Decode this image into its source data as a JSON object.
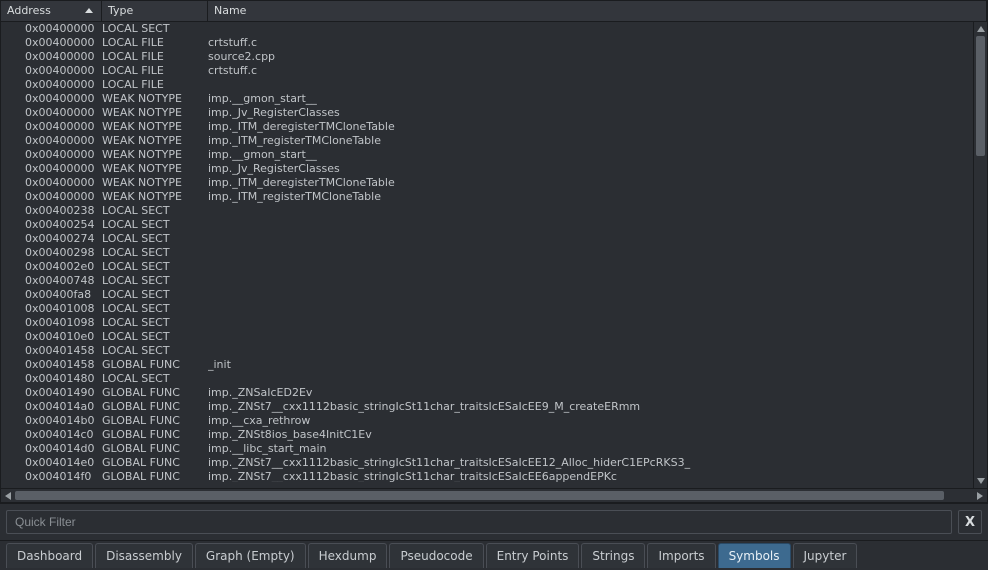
{
  "columns": {
    "address": "Address",
    "type": "Type",
    "name": "Name"
  },
  "filter": {
    "placeholder": "Quick Filter",
    "clear_label": "X"
  },
  "tabs": [
    {
      "id": "dashboard",
      "label": "Dashboard",
      "active": false
    },
    {
      "id": "disassembly",
      "label": "Disassembly",
      "active": false
    },
    {
      "id": "graph",
      "label": "Graph (Empty)",
      "active": false
    },
    {
      "id": "hexdump",
      "label": "Hexdump",
      "active": false
    },
    {
      "id": "pseudocode",
      "label": "Pseudocode",
      "active": false
    },
    {
      "id": "entrypoints",
      "label": "Entry Points",
      "active": false
    },
    {
      "id": "strings",
      "label": "Strings",
      "active": false
    },
    {
      "id": "imports",
      "label": "Imports",
      "active": false
    },
    {
      "id": "symbols",
      "label": "Symbols",
      "active": true
    },
    {
      "id": "jupyter",
      "label": "Jupyter",
      "active": false
    }
  ],
  "rows": [
    {
      "address": "0x00400000",
      "type": "LOCAL SECT",
      "name": ""
    },
    {
      "address": "0x00400000",
      "type": "LOCAL FILE",
      "name": "crtstuff.c"
    },
    {
      "address": "0x00400000",
      "type": "LOCAL FILE",
      "name": "source2.cpp"
    },
    {
      "address": "0x00400000",
      "type": "LOCAL FILE",
      "name": "crtstuff.c"
    },
    {
      "address": "0x00400000",
      "type": "LOCAL FILE",
      "name": ""
    },
    {
      "address": "0x00400000",
      "type": "WEAK NOTYPE",
      "name": "imp.__gmon_start__"
    },
    {
      "address": "0x00400000",
      "type": "WEAK NOTYPE",
      "name": "imp._Jv_RegisterClasses"
    },
    {
      "address": "0x00400000",
      "type": "WEAK NOTYPE",
      "name": "imp._ITM_deregisterTMCloneTable"
    },
    {
      "address": "0x00400000",
      "type": "WEAK NOTYPE",
      "name": "imp._ITM_registerTMCloneTable"
    },
    {
      "address": "0x00400000",
      "type": "WEAK NOTYPE",
      "name": "imp.__gmon_start__"
    },
    {
      "address": "0x00400000",
      "type": "WEAK NOTYPE",
      "name": "imp._Jv_RegisterClasses"
    },
    {
      "address": "0x00400000",
      "type": "WEAK NOTYPE",
      "name": "imp._ITM_deregisterTMCloneTable"
    },
    {
      "address": "0x00400000",
      "type": "WEAK NOTYPE",
      "name": "imp._ITM_registerTMCloneTable"
    },
    {
      "address": "0x00400238",
      "type": "LOCAL SECT",
      "name": ""
    },
    {
      "address": "0x00400254",
      "type": "LOCAL SECT",
      "name": ""
    },
    {
      "address": "0x00400274",
      "type": "LOCAL SECT",
      "name": ""
    },
    {
      "address": "0x00400298",
      "type": "LOCAL SECT",
      "name": ""
    },
    {
      "address": "0x004002e0",
      "type": "LOCAL SECT",
      "name": ""
    },
    {
      "address": "0x00400748",
      "type": "LOCAL SECT",
      "name": ""
    },
    {
      "address": "0x00400fa8",
      "type": "LOCAL SECT",
      "name": ""
    },
    {
      "address": "0x00401008",
      "type": "LOCAL SECT",
      "name": ""
    },
    {
      "address": "0x00401098",
      "type": "LOCAL SECT",
      "name": ""
    },
    {
      "address": "0x004010e0",
      "type": "LOCAL SECT",
      "name": ""
    },
    {
      "address": "0x00401458",
      "type": "LOCAL SECT",
      "name": ""
    },
    {
      "address": "0x00401458",
      "type": "GLOBAL FUNC",
      "name": "_init"
    },
    {
      "address": "0x00401480",
      "type": "LOCAL SECT",
      "name": ""
    },
    {
      "address": "0x00401490",
      "type": "GLOBAL FUNC",
      "name": "imp._ZNSaIcED2Ev"
    },
    {
      "address": "0x004014a0",
      "type": "GLOBAL FUNC",
      "name": "imp._ZNSt7__cxx1112basic_stringIcSt11char_traitsIcESaIcEE9_M_createERmm"
    },
    {
      "address": "0x004014b0",
      "type": "GLOBAL FUNC",
      "name": "imp.__cxa_rethrow"
    },
    {
      "address": "0x004014c0",
      "type": "GLOBAL FUNC",
      "name": "imp._ZNSt8ios_base4InitC1Ev"
    },
    {
      "address": "0x004014d0",
      "type": "GLOBAL FUNC",
      "name": "imp.__libc_start_main"
    },
    {
      "address": "0x004014e0",
      "type": "GLOBAL FUNC",
      "name": "imp._ZNSt7__cxx1112basic_stringIcSt11char_traitsIcESaIcEE12_Alloc_hiderC1EPcRKS3_"
    },
    {
      "address": "0x004014f0",
      "type": "GLOBAL FUNC",
      "name": "imp._ZNSt7__cxx1112basic_stringIcSt11char_traitsIcESaIcEE6appendEPKc"
    }
  ]
}
